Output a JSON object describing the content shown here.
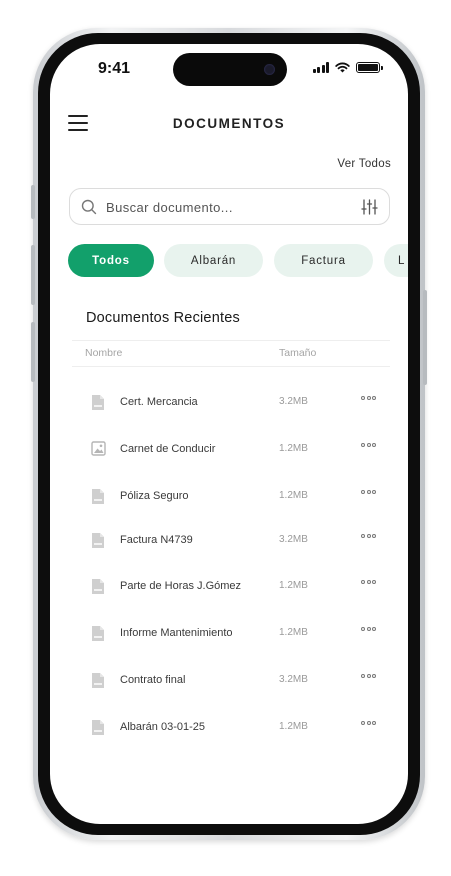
{
  "status_bar": {
    "time": "9:41"
  },
  "header": {
    "title": "DOCUMENTOS",
    "see_all": "Ver Todos"
  },
  "search": {
    "placeholder": "Buscar documento..."
  },
  "filters": [
    {
      "label": "Todos",
      "active": true
    },
    {
      "label": "Albarán",
      "active": false
    },
    {
      "label": "Factura",
      "active": false
    },
    {
      "label": "L",
      "active": false
    }
  ],
  "documents_section": {
    "title": "Documentos Recientes",
    "columns": {
      "name": "Nombre",
      "size": "Tamaño"
    },
    "rows": [
      {
        "name": "Cert. Mercancia",
        "size": "3.2MB",
        "icon": "file-icon"
      },
      {
        "name": "Carnet de Conducir",
        "size": "1.2MB",
        "icon": "image-icon"
      },
      {
        "name": "Póliza Seguro",
        "size": "1.2MB",
        "icon": "file-icon"
      },
      {
        "name": "Factura N4739",
        "size": "3.2MB",
        "icon": "file-icon"
      },
      {
        "name": "Parte de Horas J.Gómez",
        "size": "1.2MB",
        "icon": "file-icon"
      },
      {
        "name": "Informe Mantenimiento",
        "size": "1.2MB",
        "icon": "file-icon"
      },
      {
        "name": "Contrato final",
        "size": "3.2MB",
        "icon": "file-icon"
      },
      {
        "name": "Albarán 03-01-25",
        "size": "1.2MB",
        "icon": "file-icon"
      }
    ]
  },
  "colors": {
    "accent": "#12a06b",
    "chip_bg": "#e8f3ee",
    "icon_gray": "#c9c9c9"
  }
}
